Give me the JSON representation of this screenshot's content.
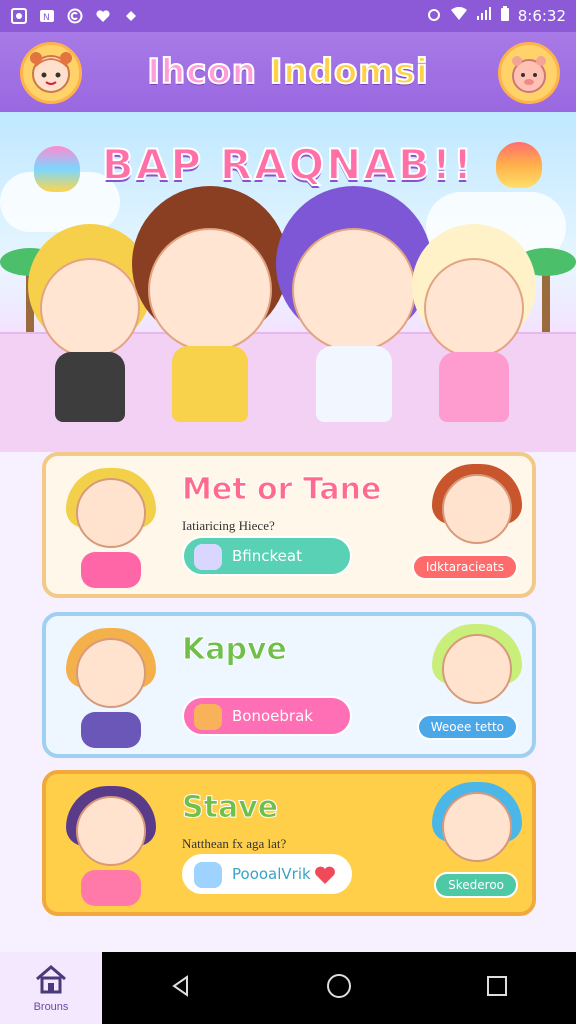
{
  "status_bar": {
    "time": "8:6:32"
  },
  "header": {
    "title_part1": "Ihcon",
    "title_part2": "Indomsi"
  },
  "hero": {
    "banner": "BAP RAQNAB!!"
  },
  "cards": [
    {
      "title": "Met or Tane",
      "subtitle": "Iatiaricing Hiece?",
      "button_label": "Bfinckeat",
      "tag_label": "Idktaracieats"
    },
    {
      "title": "Kapve",
      "subtitle": "",
      "button_label": "Bonoebrak",
      "tag_label": "Weoee tetto"
    },
    {
      "title": "Stave",
      "subtitle": "Natthean fx aga lat?",
      "button_label": "PoooalVrik",
      "tag_label": "Skederoo"
    }
  ],
  "bottom_nav": {
    "home_label": "Brouns"
  },
  "colors": {
    "primary": "#9a68e0",
    "accent_pink": "#ff6fb5",
    "accent_teal": "#58d1b5",
    "accent_yellow": "#ffcf4a"
  }
}
